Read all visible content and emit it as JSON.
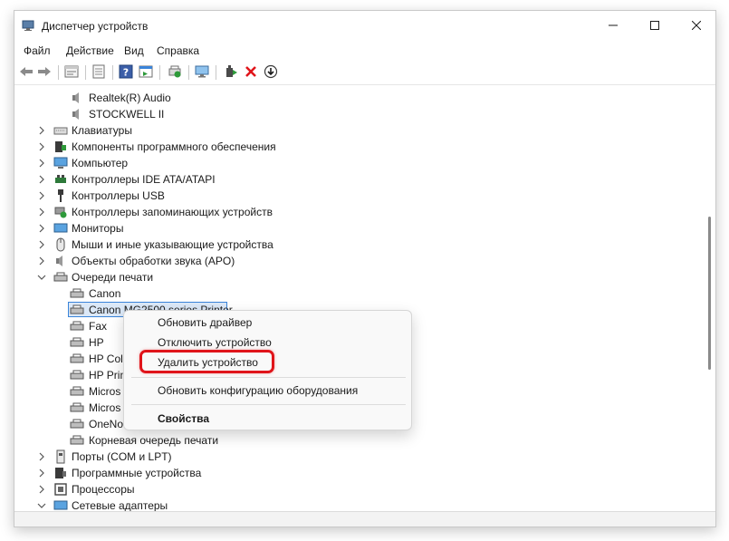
{
  "window": {
    "title": "Диспетчер устройств"
  },
  "menu": [
    "Файл",
    "Действие",
    "Вид",
    "Справка"
  ],
  "toolbar": {
    "icons": [
      "back-arrow-icon",
      "forward-arrow-icon",
      "properties-icon",
      "show-hide-icon",
      "help-icon",
      "action-pane-icon",
      "scan-hardware-icon",
      "monitor-icon",
      "update-driver-icon",
      "uninstall-x-icon",
      "download-icon"
    ]
  },
  "tree": {
    "realtek": "Realtek(R) Audio",
    "stockwell": "STOCKWELL II",
    "keyboards": "Клавиатуры",
    "software_components": "Компоненты программного обеспечения",
    "computer": "Компьютер",
    "ide": "Контроллеры IDE ATA/ATAPI",
    "usb": "Контроллеры USB",
    "storage": "Контроллеры запоминающих устройств",
    "monitors": "Мониторы",
    "mice": "Мыши и иные указывающие устройства",
    "apo": "Объекты обработки звука (APO)",
    "print_queues": "Очереди печати",
    "canon": "Canon",
    "canon_mg": "Canon MG2500 series Printer",
    "fax": "Fax",
    "hp": "HP",
    "hp_color": "HP Col",
    "hp_print": "HP Prin",
    "ms1": "Micros",
    "ms2": "Micros",
    "onenote": "OneNo",
    "root_queue": "Корневая очередь печати",
    "ports": "Порты (COM и LPT)",
    "software_devices": "Программные устройства",
    "processors": "Процессоры",
    "network": "Сетевые адаптеры"
  },
  "context_menu": {
    "update_driver": "Обновить драйвер",
    "disable_device": "Отключить устройство",
    "uninstall_device": "Удалить устройство",
    "scan_hardware": "Обновить конфигурацию оборудования",
    "properties": "Свойства"
  },
  "colors": {
    "highlight": "#e0141a",
    "selection": "#dbe8f7",
    "selection_border": "#3a84d9"
  }
}
